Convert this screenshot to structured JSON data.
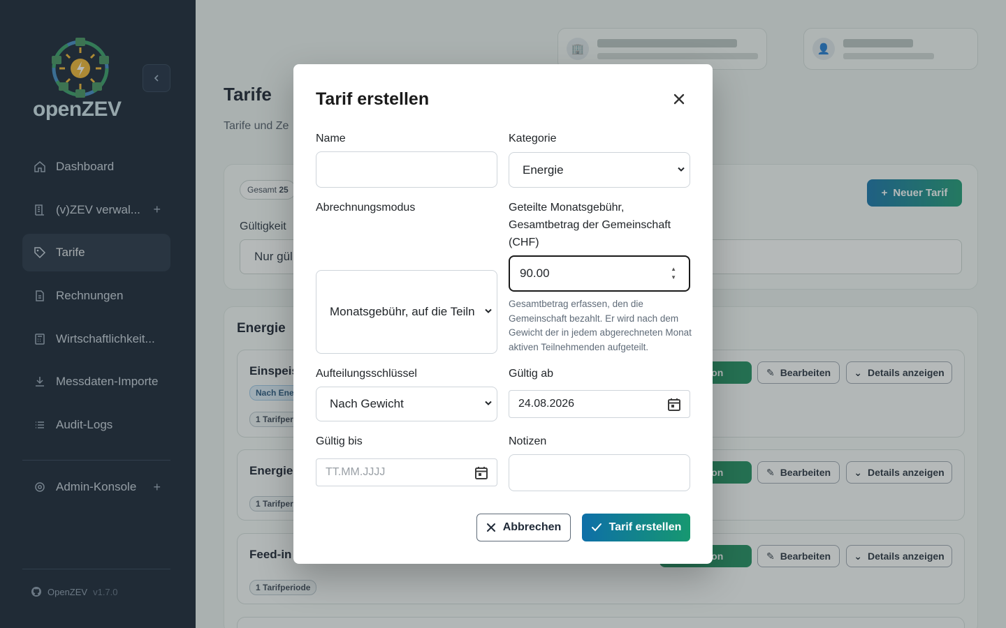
{
  "sidebar": {
    "logo_text": "openZEV",
    "items": [
      {
        "label": "Dashboard",
        "icon": "home-icon"
      },
      {
        "label": "(v)ZEV verwal...",
        "icon": "building-icon",
        "plus": "+"
      },
      {
        "label": "Tarife",
        "icon": "tag-icon"
      },
      {
        "label": "Rechnungen",
        "icon": "document-icon"
      },
      {
        "label": "Wirtschaftlichkeit...",
        "icon": "calculator-icon"
      },
      {
        "label": "Messdaten-Importe",
        "icon": "download-icon"
      },
      {
        "label": "Audit-Logs",
        "icon": "list-icon"
      }
    ],
    "admin": {
      "label": "Admin-Konsole",
      "plus": "+"
    },
    "version_name": "OpenZEV",
    "version_num": "v1.7.0"
  },
  "main": {
    "page_title": "Tarife",
    "page_subtitle": "Tarife und Ze",
    "chip_total_label": "Gesamt",
    "chip_total_value": "25",
    "validity_label": "Gültigkeit",
    "validity_value": "Nur gül",
    "new_button": "Neuer Tarif",
    "section_title": "Energie",
    "cards": [
      {
        "title": "Einspeis",
        "badge": "Nach Ene",
        "badge2": "1 Tarifper",
        "v": "Version",
        "edit": "Bearbeiten",
        "details": "Details anzeigen"
      },
      {
        "title": "Energie",
        "badge2": "1 Tarifper",
        "v": "Version",
        "edit": "Bearbeiten",
        "details": "Details anzeigen"
      },
      {
        "title": "Feed-in",
        "badge2": "1 Tarifperiode",
        "v": "Version",
        "edit": "Bearbeiten",
        "details": "Details anzeigen"
      }
    ]
  },
  "modal": {
    "title": "Tarif erstellen",
    "name_label": "Name",
    "name_value": "",
    "category_label": "Kategorie",
    "category_value": "Energie",
    "billing_mode_label": "Abrechnungsmodus",
    "billing_mode_value": "Monatsgebühr, auf die Teiln",
    "monthly_fee_label": "Geteilte Monatsgebühr, Gesamtbetrag der Gemeinschaft (CHF)",
    "monthly_fee_value": "90.00",
    "monthly_fee_help": "Gesamtbetrag erfassen, den die Gemeinschaft bezahlt. Er wird nach dem Gewicht der in jedem abgerechneten Monat aktiven Teilnehmenden aufgeteilt.",
    "split_key_label": "Aufteilungsschlüssel",
    "split_key_value": "Nach Gewicht",
    "valid_from_label": "Gültig ab",
    "valid_from_value": "24.08.2026",
    "valid_to_label": "Gültig bis",
    "valid_to_placeholder": "TT.MM.JJJJ",
    "notes_label": "Notizen",
    "notes_value": "",
    "cancel_label": "Abbrechen",
    "create_label": "Tarif erstellen"
  },
  "colors": {
    "sidebar_bg": "#0f1b2d",
    "accent_start": "#0e6fa8",
    "accent_end": "#169870"
  }
}
